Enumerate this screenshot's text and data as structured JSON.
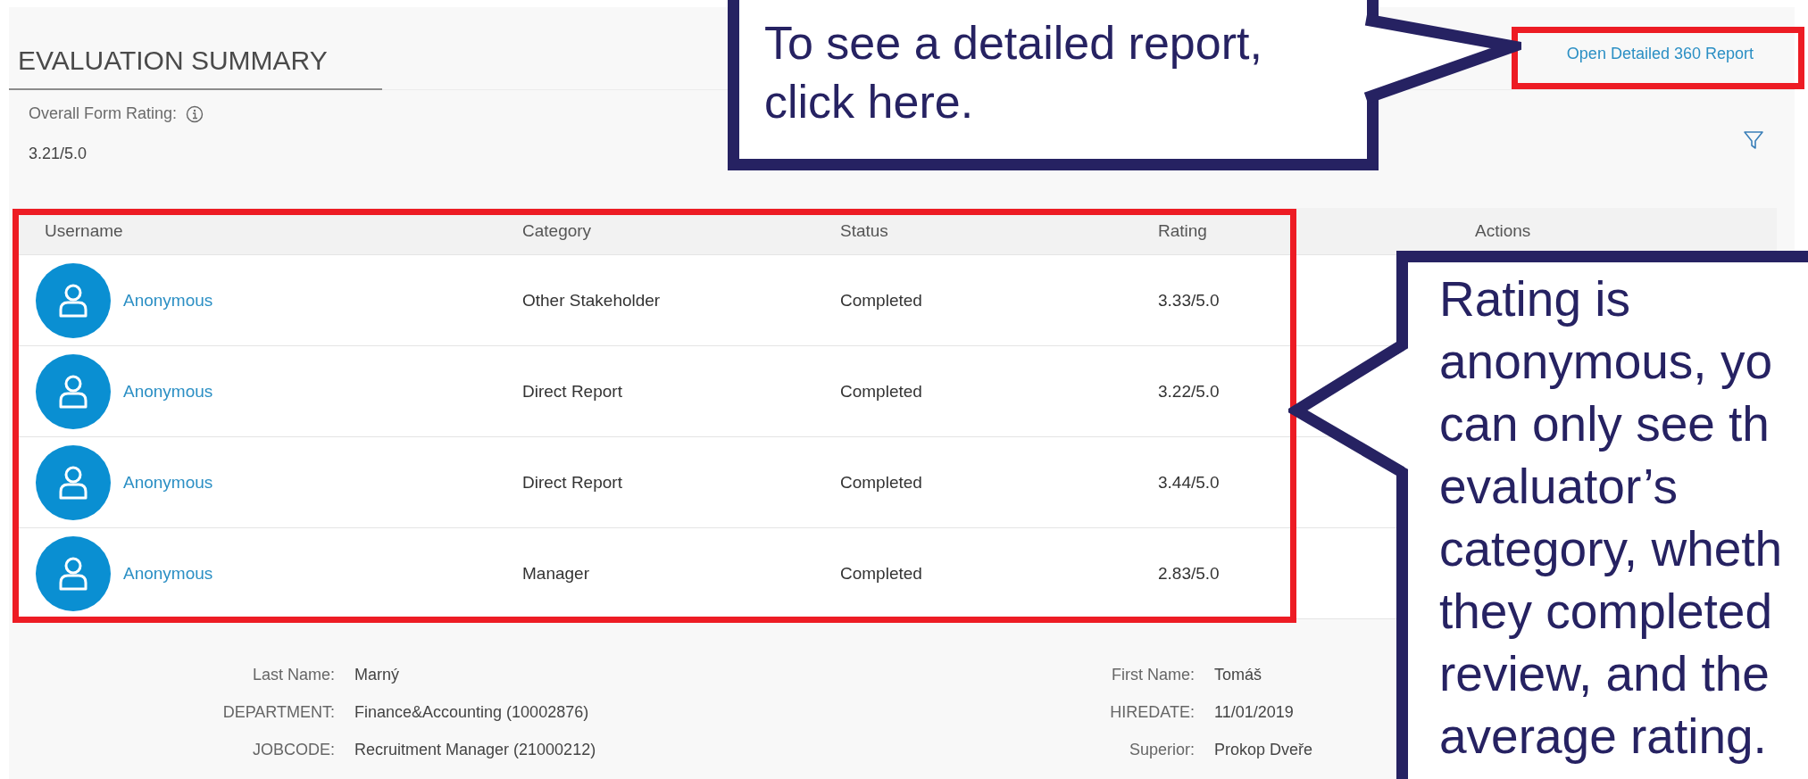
{
  "section": {
    "title": "EVALUATION SUMMARY",
    "link": "Open Detailed 360 Report",
    "overall_rating": {
      "label": "Overall Form Rating:",
      "value": "3.21/5.0"
    }
  },
  "table": {
    "columns": [
      "Username",
      "Category",
      "Status",
      "Rating",
      "Actions"
    ],
    "rows": [
      {
        "username": "Anonymous",
        "category": "Other Stakeholder",
        "status": "Completed",
        "rating": "3.33/5.0"
      },
      {
        "username": "Anonymous",
        "category": "Direct Report",
        "status": "Completed",
        "rating": "3.22/5.0"
      },
      {
        "username": "Anonymous",
        "category": "Direct Report",
        "status": "Completed",
        "rating": "3.44/5.0"
      },
      {
        "username": "Anonymous",
        "category": "Manager",
        "status": "Completed",
        "rating": "2.83/5.0"
      }
    ]
  },
  "details": {
    "left": [
      {
        "label": "Last Name:",
        "value": "Marný"
      },
      {
        "label": "DEPARTMENT:",
        "value": "Finance&Accounting (10002876)"
      },
      {
        "label": "JOBCODE:",
        "value": "Recruitment Manager (21000212)"
      }
    ],
    "right": [
      {
        "label": "First Name:",
        "value": "Tomáš"
      },
      {
        "label": "HIREDATE:",
        "value": "11/01/2019"
      },
      {
        "label": "Superior:",
        "value": "Prokop Dveře"
      }
    ]
  },
  "callouts": [
    {
      "kind": "top",
      "lines": [
        "To see a detailed report,",
        "click here."
      ]
    },
    {
      "kind": "side",
      "lines": [
        "Rating is",
        "anonymous, yo",
        "can only see th",
        "evaluator’s",
        "category, wheth",
        "they completed",
        "review, and the",
        "average rating."
      ]
    }
  ]
}
